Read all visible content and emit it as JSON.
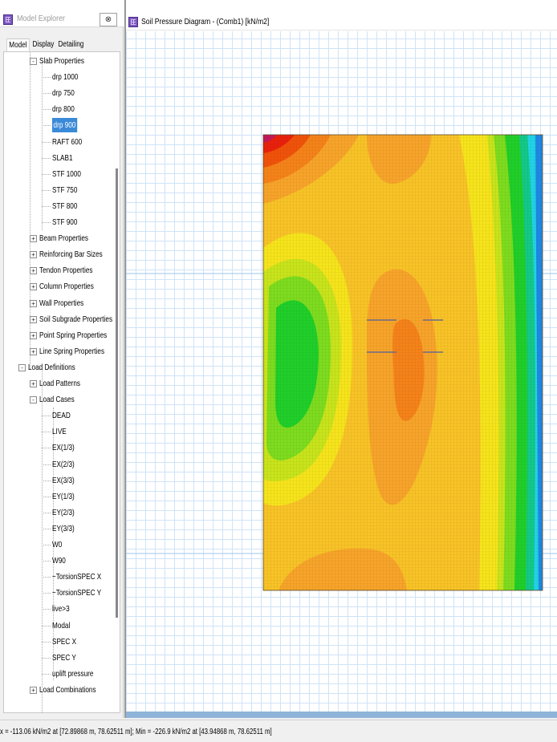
{
  "explorer": {
    "title": "Model Explorer",
    "close_glyph": "⊗",
    "tabs": [
      "Model",
      "Display",
      "Detailing"
    ],
    "tree": [
      {
        "label": "Slab Properties",
        "level": 2,
        "expander": "-"
      },
      {
        "label": "drp 1000",
        "level": 3
      },
      {
        "label": "drp 750",
        "level": 3
      },
      {
        "label": "drp 800",
        "level": 3
      },
      {
        "label": "drp 900",
        "level": 3,
        "selected": true
      },
      {
        "label": "RAFT 600",
        "level": 3
      },
      {
        "label": "SLAB1",
        "level": 3
      },
      {
        "label": "STF 1000",
        "level": 3
      },
      {
        "label": "STF 750",
        "level": 3
      },
      {
        "label": "STF 800",
        "level": 3
      },
      {
        "label": "STF 900",
        "level": 3
      },
      {
        "label": "Beam Properties",
        "level": 2,
        "expander": "+"
      },
      {
        "label": "Reinforcing Bar Sizes",
        "level": 2,
        "expander": "+"
      },
      {
        "label": "Tendon Properties",
        "level": 2,
        "expander": "+"
      },
      {
        "label": "Column Properties",
        "level": 2,
        "expander": "+"
      },
      {
        "label": "Wall Properties",
        "level": 2,
        "expander": "+"
      },
      {
        "label": "Soil Subgrade Properties",
        "level": 2,
        "expander": "+"
      },
      {
        "label": "Point Spring Properties",
        "level": 2,
        "expander": "+"
      },
      {
        "label": "Line Spring Properties",
        "level": 2,
        "expander": "+"
      },
      {
        "label": "Load Definitions",
        "level": 1,
        "expander": "-"
      },
      {
        "label": "Load Patterns",
        "level": 2,
        "expander": "+"
      },
      {
        "label": "Load Cases",
        "level": 2,
        "expander": "-"
      },
      {
        "label": "DEAD",
        "level": 3
      },
      {
        "label": "LIVE",
        "level": 3
      },
      {
        "label": "EX(1/3)",
        "level": 3
      },
      {
        "label": "EX(2/3)",
        "level": 3
      },
      {
        "label": "EX(3/3)",
        "level": 3
      },
      {
        "label": "EY(1/3)",
        "level": 3
      },
      {
        "label": "EY(2/3)",
        "level": 3
      },
      {
        "label": "EY(3/3)",
        "level": 3
      },
      {
        "label": "W0",
        "level": 3
      },
      {
        "label": "W90",
        "level": 3
      },
      {
        "label": "~TorsionSPEC X",
        "level": 3
      },
      {
        "label": "~TorsionSPEC Y",
        "level": 3
      },
      {
        "label": "live>3",
        "level": 3
      },
      {
        "label": "Modal",
        "level": 3
      },
      {
        "label": "SPEC X",
        "level": 3
      },
      {
        "label": "SPEC Y",
        "level": 3
      },
      {
        "label": "uplift pressure",
        "level": 3
      },
      {
        "label": "Load Combinations",
        "level": 2,
        "expander": "+"
      }
    ]
  },
  "diagram": {
    "title": "Soil Pressure Diagram - (Comb1)  [kN/m2]",
    "contour_colors": {
      "magenta": "#c2185b",
      "red": "#e8200c",
      "orange_red": "#f0520a",
      "orange": "#f5821a",
      "light_orange": "#f7a42a",
      "amber": "#f8c327",
      "yellow": "#f6e41c",
      "yellow_green": "#c8e41c",
      "light_green": "#7ddc1f",
      "green": "#1fcf2a",
      "teal": "#12c98a",
      "cyan": "#1fd4e6",
      "blue": "#1e88e5"
    }
  },
  "status": {
    "text": "x = -113.06 kN/m2 at [72.89868 m, 78.62511 m];  Min = -226.9 kN/m2 at [43.94868 m, 78.62511 m]"
  }
}
